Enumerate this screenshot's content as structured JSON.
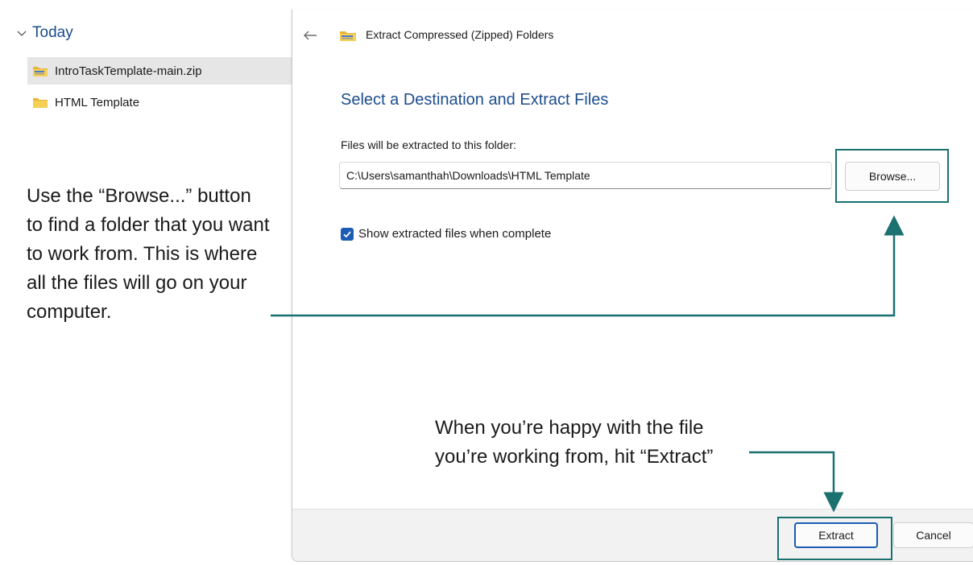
{
  "explorer": {
    "group_label": "Today",
    "items": [
      {
        "name": "IntroTaskTemplate-main.zip",
        "icon": "zip-folder-icon",
        "selected": true
      },
      {
        "name": "HTML Template",
        "icon": "folder-icon",
        "selected": false
      }
    ]
  },
  "dialog": {
    "title": "Extract Compressed (Zipped) Folders",
    "heading": "Select a Destination and Extract Files",
    "field_label": "Files will be extracted to this folder:",
    "path_value": "C:\\Users\\samanthah\\Downloads\\HTML Template",
    "browse_label": "Browse...",
    "checkbox_label": "Show extracted files when complete",
    "checkbox_checked": true,
    "extract_label": "Extract",
    "cancel_label": "Cancel"
  },
  "annotations": {
    "browse_callout": "Use the “Browse...” button to find a folder that you want to work from. This is where all the files will go on your computer.",
    "extract_callout": "When you’re happy with the file you’re working from, hit “Extract”"
  },
  "colors": {
    "accent_blue": "#1c5cb5",
    "heading_blue": "#1c4d8e",
    "annotation_teal": "#1b7070",
    "footer_bg": "#f2f2f2",
    "selected_row_bg": "#e6e6e6"
  }
}
